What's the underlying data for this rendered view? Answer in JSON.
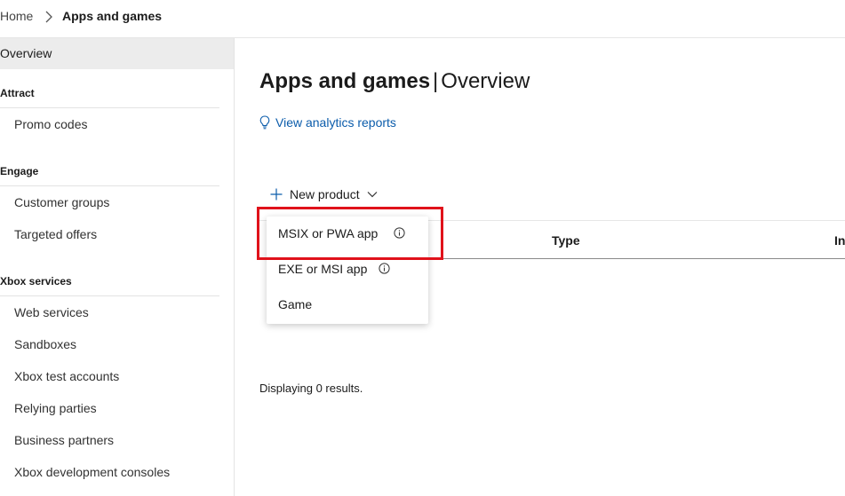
{
  "breadcrumb": {
    "home": "Home",
    "current": "Apps and games"
  },
  "sidebar": {
    "active": "Overview",
    "sections": [
      {
        "title": "Attract",
        "items": [
          "Promo codes"
        ]
      },
      {
        "title": "Engage",
        "items": [
          "Customer groups",
          "Targeted offers"
        ]
      },
      {
        "title": "Xbox services",
        "items": [
          "Web services",
          "Sandboxes",
          "Xbox test accounts",
          "Relying parties",
          "Business partners",
          "Xbox development consoles"
        ]
      }
    ]
  },
  "main": {
    "title": "Apps and games",
    "title_separator": "|",
    "subtitle": "Overview",
    "analytics_link": "View analytics reports",
    "new_product_label": "New product",
    "table_columns": [
      "Type",
      "In"
    ],
    "results_text": "Displaying 0 results."
  },
  "menu": {
    "items": [
      "MSIX or PWA app",
      "EXE or MSI app",
      "Game"
    ]
  },
  "colors": {
    "link": "#0b5cab",
    "highlight": "#e0121b",
    "active_nav_bg": "#ececec"
  },
  "icons": {
    "breadcrumb_separator": "chevron-right-icon",
    "analytics": "lightbulb-icon",
    "new_product": "plus-icon",
    "dropdown": "chevron-down-icon",
    "menu_info": "info-icon"
  }
}
